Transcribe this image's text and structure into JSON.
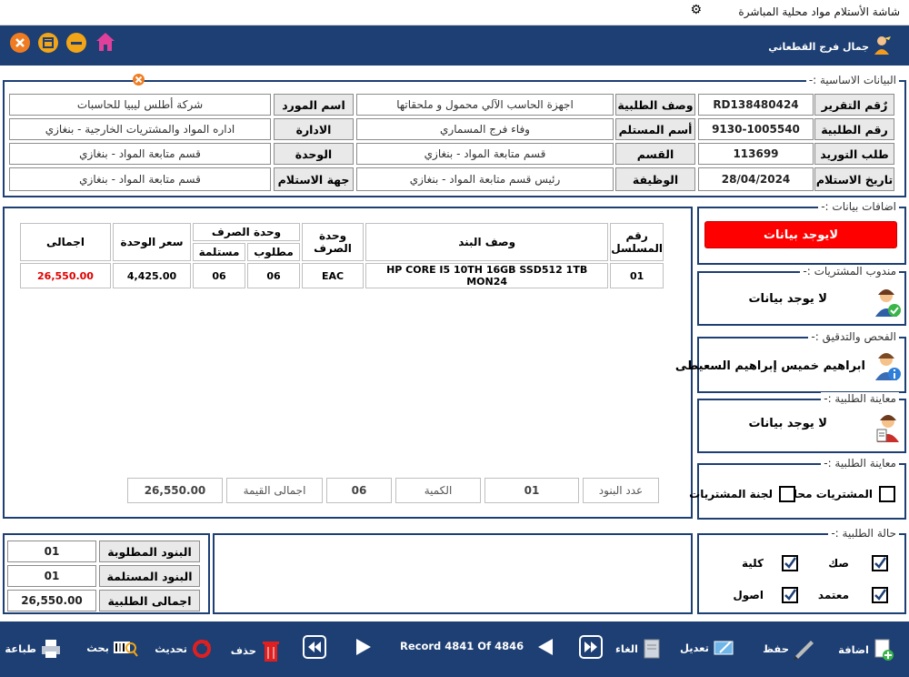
{
  "window": {
    "title": "شاشة الأستلام مواد محلية المباشرة"
  },
  "header": {
    "user": "جمال فرج القطعاني"
  },
  "basic": {
    "title": "البيانات الاساسية :-",
    "report_no_label": "رٌقم التقرير",
    "report_no": "RD138480424",
    "request_no_label": "رقم الطلبية",
    "request_no": "9130-1005540",
    "supply_label": "طلب التوريد",
    "supply": "113699",
    "receive_date_label": "تاريخ الاستلام",
    "receive_date": "28/04/2024",
    "req_desc_label": "وصف الطلبية",
    "req_desc": "اجهزة الحاسب الآلي محمول و ملحقاتها",
    "receiver_label": "أسم المستلم",
    "receiver": "وفاء فرج المسماري",
    "section_label": "القسم",
    "section": "قسم متابعة المواد - بنغازي",
    "job_label": "الوظيفة",
    "job": "رئيس قسم متابعة المواد - بنغازي",
    "supplier_label": "اسم المورد",
    "supplier": "شركة أطلس ليبيا للحاسبات",
    "admin_label": "الادارة",
    "admin": "اداره المواد والمشتريات الخارجية  -  بنغازي",
    "unit_label": "الوحدة",
    "unit": "قسم متابعة المواد - بنغازي",
    "recv_party_label": "جهة الاستلام",
    "recv_party": "قسم متابعة المواد - بنغازي"
  },
  "table": {
    "h_serial": "رقم المسلسل",
    "h_desc": "وصف البند",
    "h_unit": "وحدة الصرف",
    "h_disp_unit": "وحدة الصرف",
    "h_required": "مطلوب",
    "h_received": "مستلمة",
    "h_price": "سعر الوحدة",
    "h_total": "اجمالى",
    "rows": [
      {
        "serial": "01",
        "desc": "HP CORE I5 10TH 16GB SSD512 1TB MON24",
        "unit": "EAC",
        "required": "06",
        "received": "06",
        "price": "4,425.00",
        "total": "26,550.00"
      }
    ]
  },
  "summary": {
    "items_count_label": "عدد البنود",
    "items_count": "01",
    "qty_label": "الكمية",
    "qty": "06",
    "total_value_label": "اجمالى القيمة",
    "total_value": "26,550.00"
  },
  "totals": {
    "req_items_label": "البنود المطلوبة",
    "req_items": "01",
    "recv_items_label": "البنود المستلمة",
    "recv_items": "01",
    "total_label": "اجمالى الطلبية",
    "total": "26,550.00"
  },
  "additions": {
    "title": "اضافات بيانات :-",
    "no_data": "لايوجد بيانات"
  },
  "purchasing_rep": {
    "title": "مندوب المشتريات :-",
    "name": "لا يوجد بيانات"
  },
  "inspection": {
    "title": "الفحص والتدقيق :-",
    "name": "ابراهيم خميس إبراهيم السعيطى"
  },
  "request_review": {
    "title": "معاينة الطلبية :-",
    "name": "لا يوجد بيانات"
  },
  "request_review2": {
    "title": "معاينة الطلبية :-",
    "local": "المشتريات محلية",
    "committee": "لجنة المشتريات"
  },
  "status": {
    "title": "حالة الطلبية :-",
    "check": "صك",
    "total": "كلية",
    "approved": "معتمد",
    "original": "اصول"
  },
  "footer": {
    "add": "اضافة",
    "save": "حفظ",
    "edit": "تعديل",
    "cancel": "الغاء",
    "record": "Record 4841 Of 4846",
    "delete": "حذف",
    "refresh": "تحديث",
    "search": "بحث",
    "print": "طباعة"
  },
  "colors": {
    "header": "#1d3f73",
    "accent_red": "#ff0000",
    "total_red": "#e00000"
  }
}
